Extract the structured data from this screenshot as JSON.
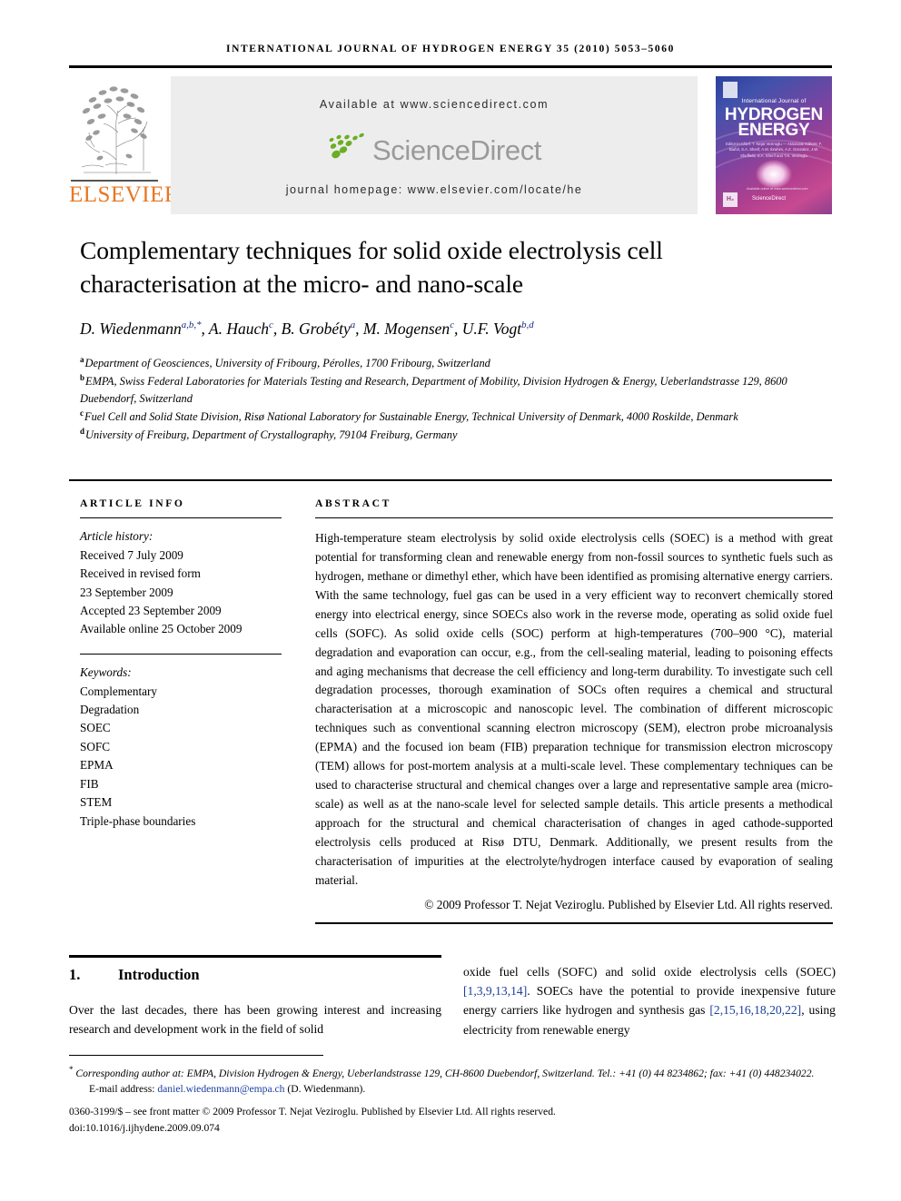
{
  "running_head": "INTERNATIONAL JOURNAL OF HYDROGEN ENERGY 35 (2010) 5053–5060",
  "masthead": {
    "publisher_name": "ELSEVIER",
    "available_at": "Available at www.sciencedirect.com",
    "sciencedirect_word": "ScienceDirect",
    "journal_homepage": "journal homepage: www.elsevier.com/locate/he",
    "cover": {
      "line1": "International Journal of",
      "line2": "HYDROGEN",
      "line3": "ENERGY",
      "editors": "Editor-in-Chief: T. Nejat Veziroglu — Associate Editors: F. Barbir, S.A. Sherif, A.M. Ibrahim, A.Z. Gonzalez, J.W. Sheffield, S.A. Sherif and T.N. Veziroglu",
      "footer_mark": "H₂",
      "footer_text": "Available online at www.sciencedirect.com",
      "sciencedirect_mark": "ScienceDirect"
    }
  },
  "article": {
    "title": "Complementary techniques for solid oxide electrolysis cell characterisation at the micro- and nano-scale",
    "authors": [
      {
        "name": "D. Wiedenmann",
        "sup": "a,b,*"
      },
      {
        "name": "A. Hauch",
        "sup": "c"
      },
      {
        "name": "B. Grobéty",
        "sup": "a"
      },
      {
        "name": "M. Mogensen",
        "sup": "c"
      },
      {
        "name": "U.F. Vogt",
        "sup": "b,d"
      }
    ],
    "affiliations": [
      {
        "marker": "a",
        "text": "Department of Geosciences, University of Fribourg, Pérolles, 1700 Fribourg, Switzerland"
      },
      {
        "marker": "b",
        "text": "EMPA, Swiss Federal Laboratories for Materials Testing and Research, Department of Mobility, Division Hydrogen & Energy, Ueberlandstrasse 129, 8600 Duebendorf, Switzerland"
      },
      {
        "marker": "c",
        "text": "Fuel Cell and Solid State Division, Risø National Laboratory for Sustainable Energy, Technical University of Denmark, 4000 Roskilde, Denmark"
      },
      {
        "marker": "d",
        "text": "University of Freiburg, Department of Crystallography, 79104 Freiburg, Germany"
      }
    ]
  },
  "article_info": {
    "heading": "ARTICLE INFO",
    "history_label": "Article history:",
    "history": [
      "Received 7 July 2009",
      "Received in revised form",
      "23 September 2009",
      "Accepted 23 September 2009",
      "Available online 25 October 2009"
    ],
    "keywords_label": "Keywords:",
    "keywords": [
      "Complementary",
      "Degradation",
      "SOEC",
      "SOFC",
      "EPMA",
      "FIB",
      "STEM",
      "Triple-phase boundaries"
    ]
  },
  "abstract": {
    "heading": "ABSTRACT",
    "body": "High-temperature steam electrolysis by solid oxide electrolysis cells (SOEC) is a method with great potential for transforming clean and renewable energy from non-fossil sources to synthetic fuels such as hydrogen, methane or dimethyl ether, which have been identified as promising alternative energy carriers. With the same technology, fuel gas can be used in a very efficient way to reconvert chemically stored energy into electrical energy, since SOECs also work in the reverse mode, operating as solid oxide fuel cells (SOFC). As solid oxide cells (SOC) perform at high-temperatures (700–900 °C), material degradation and evaporation can occur, e.g., from the cell-sealing material, leading to poisoning effects and aging mechanisms that decrease the cell efficiency and long-term durability. To investigate such cell degradation processes, thorough examination of SOCs often requires a chemical and structural characterisation at a microscopic and nanoscopic level. The combination of different microscopic techniques such as conventional scanning electron microscopy (SEM), electron probe microanalysis (EPMA) and the focused ion beam (FIB) preparation technique for transmission electron microscopy (TEM) allows for post-mortem analysis at a multi-scale level. These complementary techniques can be used to characterise structural and chemical changes over a large and representative sample area (micro-scale) as well as at the nano-scale level for selected sample details. This article presents a methodical approach for the structural and chemical characterisation of changes in aged cathode-supported electrolysis cells produced at Risø DTU, Denmark. Additionally, we present results from the characterisation of impurities at the electrolyte/hydrogen interface caused by evaporation of sealing material.",
    "copyright": "© 2009 Professor T. Nejat Veziroglu. Published by Elsevier Ltd. All rights reserved."
  },
  "body": {
    "section_number": "1.",
    "section_title": "Introduction",
    "left_paragraph": "Over the last decades, there has been growing interest and increasing research and development work in the field of solid",
    "right_part1": "oxide fuel cells (SOFC) and solid oxide electrolysis cells (SOEC)",
    "right_cite1": "[1,3,9,13,14]",
    "right_part2": ". SOECs have the potential to provide inexpensive future energy carriers like hydrogen and synthesis gas ",
    "right_cite2": "[2,15,16,18,20,22]",
    "right_part3": ", using electricity from renewable energy"
  },
  "footnotes": {
    "star": "*",
    "corresponding": "Corresponding author at: EMPA, Division Hydrogen & Energy, Ueberlandstrasse 129, CH-8600 Duebendorf, Switzerland. Tel.: +41 (0) 44 8234862; fax: +41 (0) 448234022.",
    "email_label": "E-mail address:",
    "email": "daniel.wiedenmann@empa.ch",
    "email_suffix": "(D. Wiedenmann).",
    "issn_line": "0360-3199/$ – see front matter © 2009 Professor T. Nejat Veziroglu. Published by Elsevier Ltd. All rights reserved.",
    "doi": "doi:10.1016/j.ijhydene.2009.09.074"
  },
  "colors": {
    "elsevier_orange": "#E87722",
    "link_blue": "#1a3f9e",
    "sciencedirect_green": "#6aae23",
    "sciencedirect_gray": "#9a9a9a"
  }
}
